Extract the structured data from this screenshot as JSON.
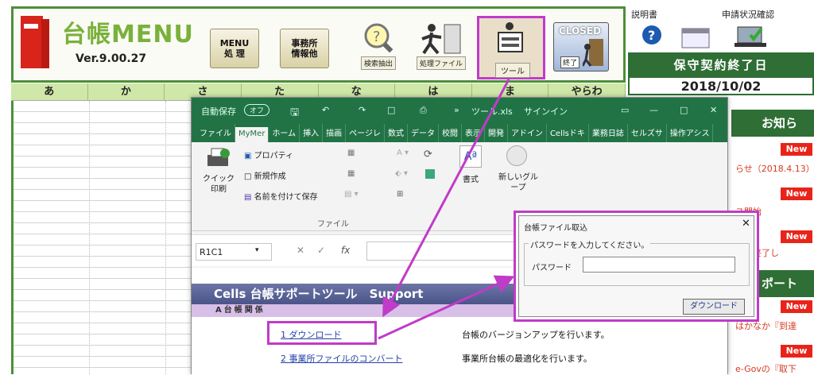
{
  "app": {
    "title": "台帳MENU",
    "version": "Ver.9.00.27"
  },
  "toolbar": {
    "menu_button": "MENU\n処 理",
    "office_button": "事務所\n情報他",
    "search_button": "検索抽出",
    "process_file_button": "処理ファイル",
    "tool_button": "ツール",
    "closed_label": "CLOSED",
    "closed_button": "終了"
  },
  "right_panel": {
    "manual_label": "説明書",
    "status_label": "申請状況確認",
    "contract_label": "保守契約終了日",
    "contract_date": "2018/10/02"
  },
  "kana_headers": [
    "あ",
    "か",
    "さ",
    "た",
    "な",
    "は",
    "ま",
    "やらわ"
  ],
  "excel": {
    "autosave": "自動保存",
    "autosave_state": "オフ",
    "filename": "ツール.xls",
    "signin": "サインイン",
    "tabs": [
      "ファイル",
      "MyMer",
      "ホーム",
      "挿入",
      "描画",
      "ページレ",
      "数式",
      "データ",
      "校閲",
      "表示",
      "開発",
      "アドイン",
      "Cellsドキ",
      "業務日誌",
      "セルズサ",
      "操作アシス"
    ],
    "ribbon": {
      "quick_print": "クイック印刷",
      "properties": "プロパティ",
      "new_create": "新規作成",
      "save_as": "名前を付けて保存",
      "group_file": "ファイル",
      "format": "書式",
      "new_group": "新しいグループ"
    },
    "namebox": "R1C1",
    "sheet_title": "Cells 台帳サポートツール　Support",
    "sheet_subtitle": "A台帳関係",
    "links": [
      {
        "label": "1 ダウンロード",
        "desc": "台帳のバージョンアップを行います。"
      },
      {
        "label": "2 事業所ファイルのコンバート",
        "desc": "事業所台帳の最適化を行います。"
      }
    ]
  },
  "dialog": {
    "title": "台帳ファイル取込",
    "group_label": "パスワードを入力してください。",
    "password_label": "パスワード",
    "password_value": "",
    "download_button": "ダウンロード",
    "close": "✕"
  },
  "news": {
    "header": "お知ら",
    "header2": "ポート",
    "badge": "New",
    "items": [
      "らせ（2018.4.13）",
      "ス開始",
      "壁を終了し",
      "はかなか『到達",
      "e-Govの『取下"
    ]
  },
  "colors": {
    "frame_green": "#4d8f3a",
    "excel_green": "#217346",
    "highlight": "#c03bc8",
    "new_red": "#e8241a"
  }
}
